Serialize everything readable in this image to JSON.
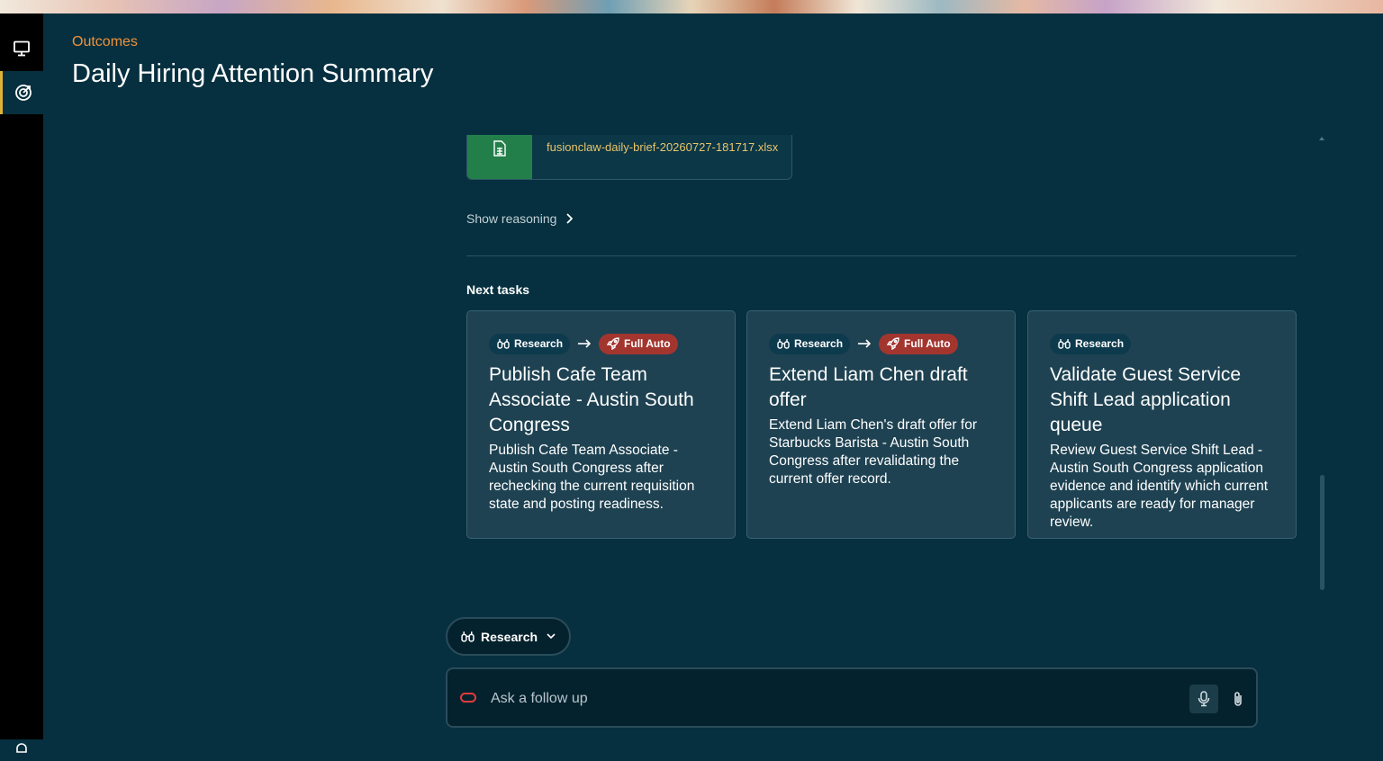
{
  "breadcrumb": "Outcomes",
  "page_title": "Daily Hiring Attention Summary",
  "attachment": {
    "file_name": "fusionclaw-daily-brief-20260727-181717.xlsx",
    "icon": "spreadsheet-icon"
  },
  "show_reasoning": "Show reasoning",
  "next_tasks_heading": "Next tasks",
  "tasks": [
    {
      "chips": [
        "Research",
        "Full Auto"
      ],
      "title": "Publish Cafe Team Associate - Austin South Congress",
      "description": "Publish Cafe Team Associate - Austin South Congress after rechecking the current requisition state and posting readiness."
    },
    {
      "chips": [
        "Research",
        "Full Auto"
      ],
      "title": "Extend Liam Chen draft offer",
      "description": "Extend Liam Chen's draft offer for Starbucks Barista - Austin South Congress after revalidating the current offer record."
    },
    {
      "chips": [
        "Research"
      ],
      "title": "Validate Guest Service Shift Lead application queue",
      "description": "Review Guest Service Shift Lead - Austin South Congress application evidence and identify which current applicants are ready for manager review."
    }
  ],
  "mode_selector": {
    "label": "Research"
  },
  "follow_up": {
    "placeholder": "Ask a follow up"
  },
  "colors": {
    "background": "#06303f",
    "accent": "#f0913b",
    "full_auto": "#a3352f",
    "file_green": "#237f4a",
    "file_name": "#e9c46a"
  }
}
